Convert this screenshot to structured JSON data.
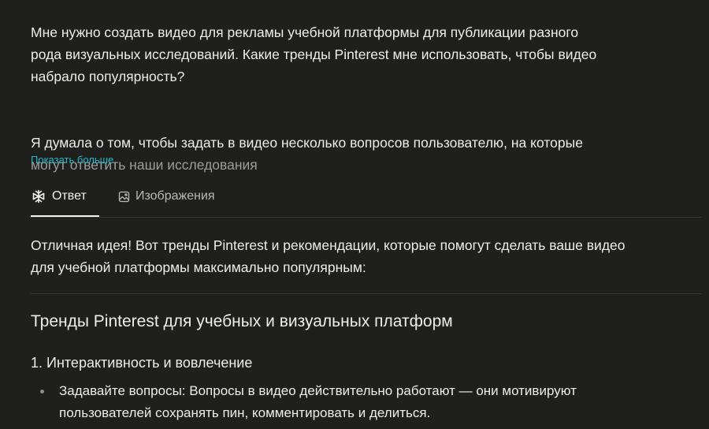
{
  "question": {
    "paragraph_1": "Мне нужно создать видео для рекламы учебной платформы для публикации разного\nрода визуальных исследований. Какие тренды Pinterest мне использовать, чтобы видео\nнабрало популярность?",
    "paragraph_2_line_1": "Я думала о том, чтобы задать в видео несколько вопросов пользователю, на которые",
    "paragraph_2_line_2": "могут ответить наши исследования",
    "show_more_label": "Показать больше"
  },
  "tabs": [
    {
      "label": "Ответ",
      "icon": "answer-spark-icon",
      "active": true
    },
    {
      "label": "Изображения",
      "icon": "image-icon",
      "active": false
    }
  ],
  "answer": {
    "intro": "Отличная идея! Вот тренды Pinterest и рекомендации, которые помогут сделать ваше видео\nдля учебной платформы максимально популярным:",
    "heading": "Тренды Pinterest для учебных и визуальных платформ",
    "subheading": "1. Интерактивность и вовлечение",
    "bullets": [
      "Задавайте вопросы: Вопросы в видео действительно работают — они мотивируют\nпользователей сохранять пин, комментировать и делиться."
    ]
  },
  "colors": {
    "background": "#1f1f1e",
    "text": "#ededeb",
    "link": "#25b9c8",
    "muted": "#9d9d9a",
    "divider": "#363635"
  }
}
